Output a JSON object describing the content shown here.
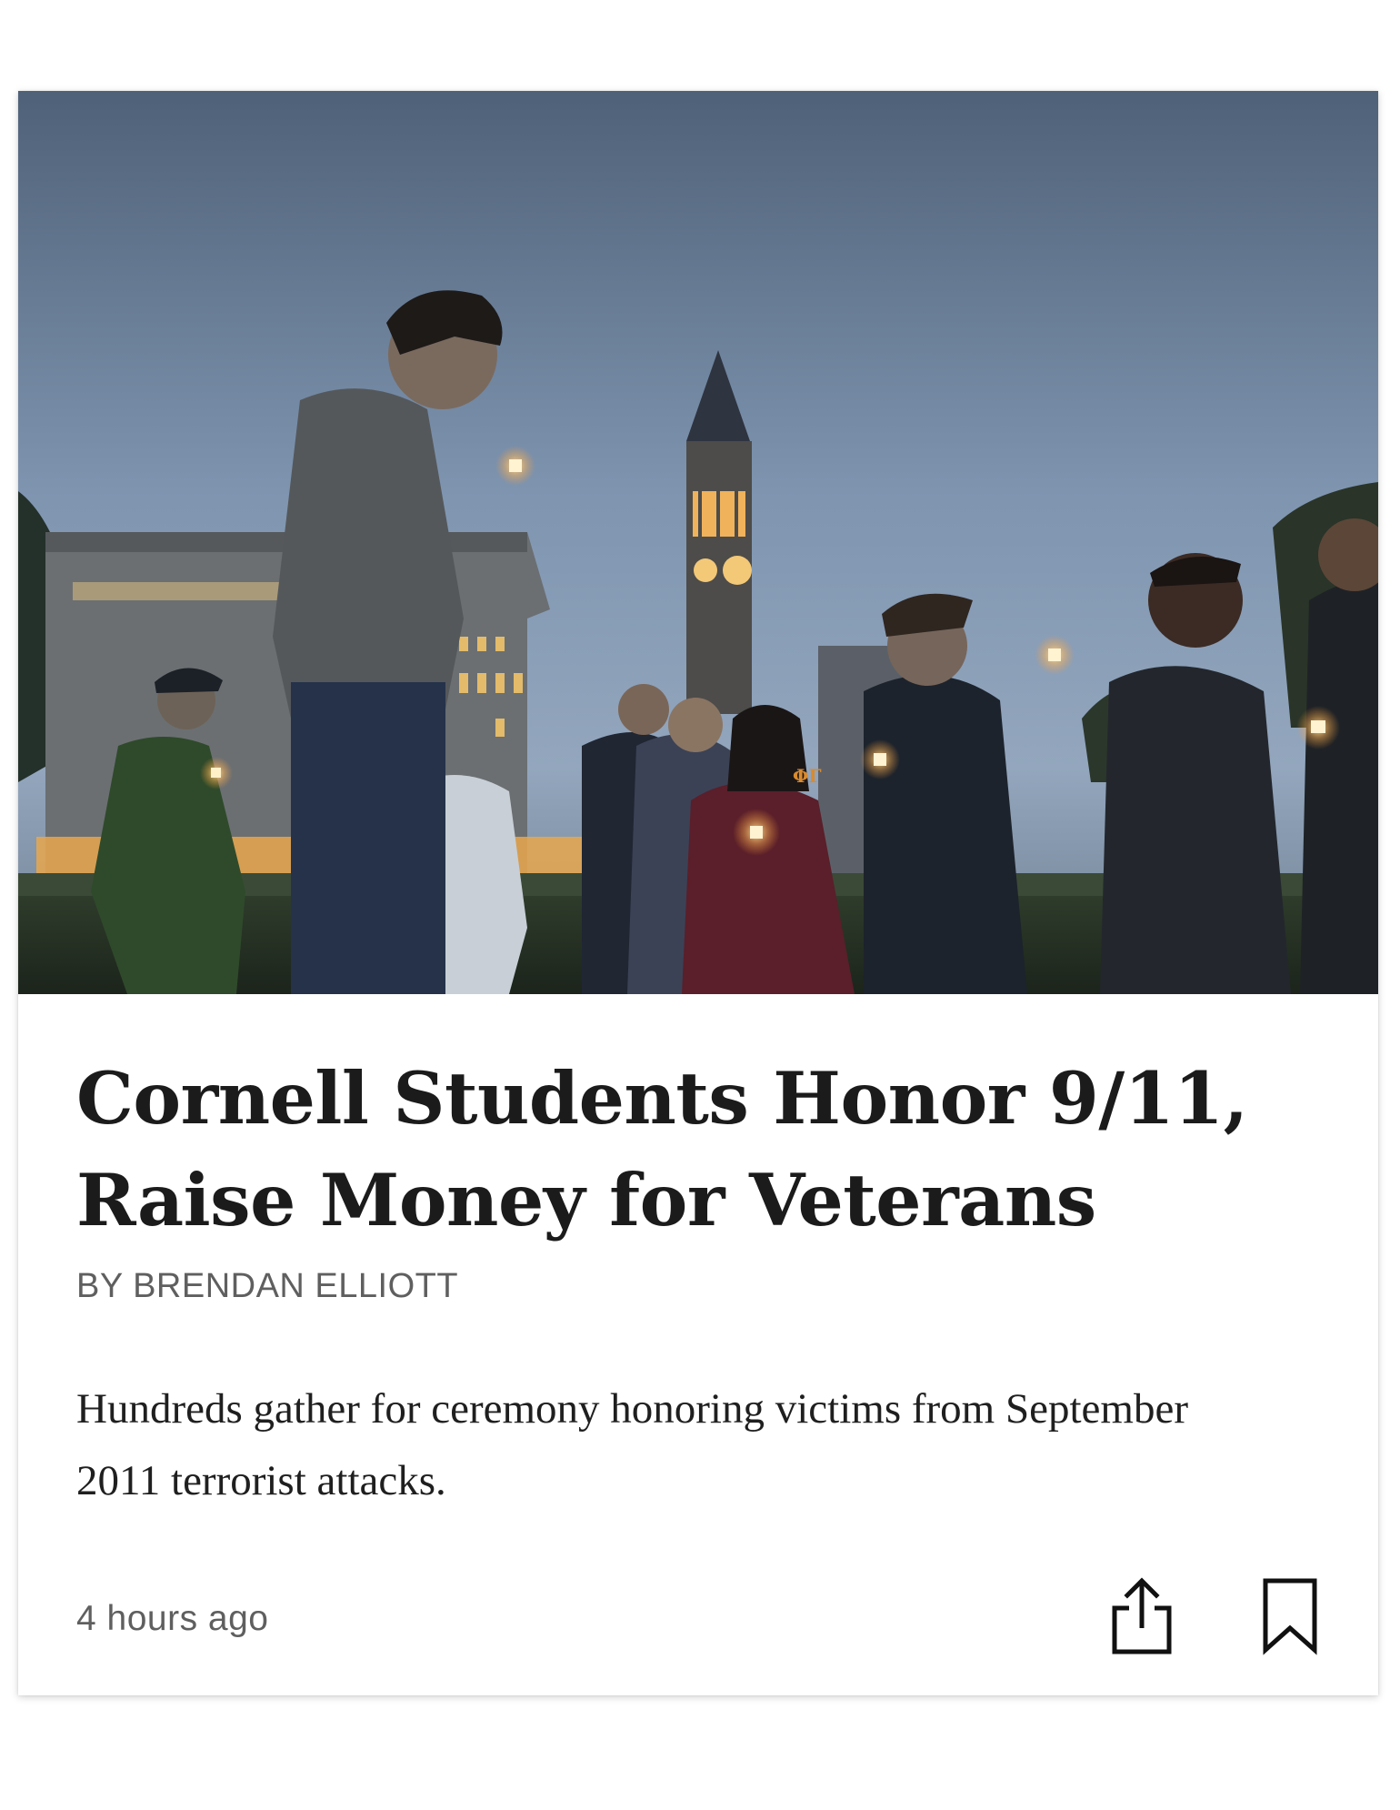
{
  "article": {
    "headline": "Cornell Students Honor 9/11, Raise Money for Veterans",
    "byline": "BY BRENDAN ELLIOTT",
    "summary": "Hundreds gather for ceremony honoring victims from September 2011 terrorist attacks.",
    "timestamp": "4 hours ago",
    "photo_caption_letters": "ΦΓ"
  },
  "actions": {
    "share_icon": "share-icon",
    "bookmark_icon": "bookmark-icon"
  },
  "colors": {
    "headline": "#1b1b1b",
    "meta": "#5f5f5f",
    "body": "#1f1f1f",
    "sky_top": "#4e6179",
    "sky_bottom": "#8fa4bd"
  }
}
